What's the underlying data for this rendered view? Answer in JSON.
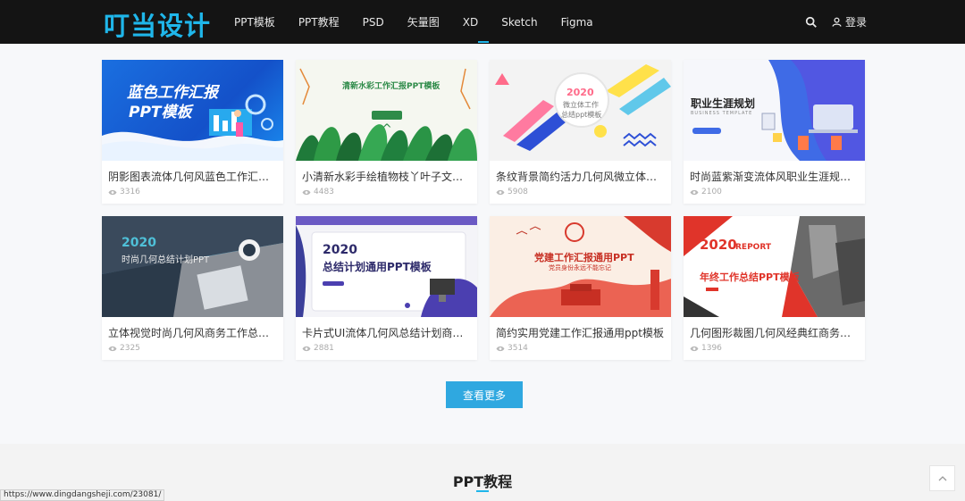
{
  "header": {
    "logo": "叮当设计",
    "menu": [
      "PPT模板",
      "PPT教程",
      "PSD",
      "矢量图",
      "XD",
      "Sketch",
      "Figma"
    ],
    "login": "登录"
  },
  "cards": [
    {
      "title": "阴影图表流体几何风蓝色工作汇报ppt...",
      "views": "3316",
      "thumb_text": "蓝色工作汇报",
      "thumb_sub": "PPT模板"
    },
    {
      "title": "小清新水彩手绘植物枝丫叶子文艺风...",
      "views": "4483",
      "thumb_text": "清新水彩工作汇报PPT模板"
    },
    {
      "title": "条纹背景简约活力几何风微立体工作...",
      "views": "5908",
      "thumb_text": "2020",
      "thumb_sub": "微立体工作",
      "thumb_sub2": "总结ppt模板"
    },
    {
      "title": "时尚蓝紫渐变流体风职业生涯规划ppt...",
      "views": "2100",
      "thumb_text": "职业生涯规划",
      "thumb_sub": "BUSINESS TEMPLATE"
    },
    {
      "title": "立体视觉时尚几何风商务工作总结报...",
      "views": "2325",
      "thumb_text": "2020",
      "thumb_sub": "时尚几何总结计划PPT"
    },
    {
      "title": "卡片式UI流体几何风总结计划商务通...",
      "views": "2881",
      "thumb_text": "2020",
      "thumb_sub": "总结计划通用PPT模板"
    },
    {
      "title": "简约实用党建工作汇报通用ppt模板",
      "views": "3514",
      "thumb_text": "党建工作汇报通用PPT",
      "thumb_sub": "党员身份永远不能忘记"
    },
    {
      "title": "几何图形裁图几何风经典红商务总结...",
      "views": "1396",
      "thumb_text": "2020",
      "thumb_sub": "REPORT",
      "thumb_sub2": "年终工作总结PPT模板"
    }
  ],
  "more_button": "查看更多",
  "section": {
    "title": "PPT教程"
  },
  "status_url": "https://www.dingdangsheji.com/23081/",
  "colors": {
    "accent": "#1fb6ea",
    "nav_bg": "#141414",
    "button": "#2fa8e0"
  },
  "icons": {
    "search": "search-icon",
    "user": "user-icon",
    "views": "eye-icon",
    "back_to_top": "chevron-up-icon"
  }
}
